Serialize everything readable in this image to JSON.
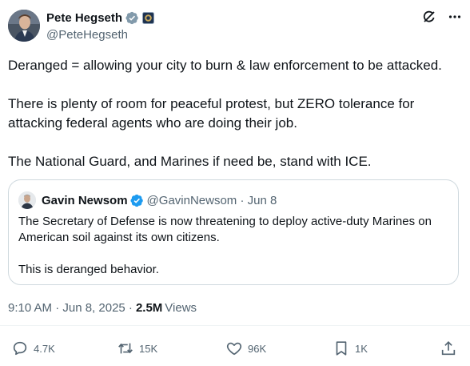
{
  "author": {
    "display_name": "Pete Hegseth",
    "handle": "@PeteHegseth"
  },
  "tweet": {
    "paragraphs": [
      "Deranged = allowing your city to burn & law enforcement to be attacked.",
      "There is plenty of room for peaceful protest, but ZERO tolerance for attacking federal agents who are doing their job.",
      "The National Guard, and Marines if need be, stand with ICE."
    ]
  },
  "quote": {
    "display_name": "Gavin Newsom",
    "handle_date": "@GavinNewsom · Jun 8",
    "paragraphs": [
      "The Secretary of Defense is now threatening to deploy active-duty Marines on American soil against its own citizens.",
      "This is deranged behavior."
    ]
  },
  "meta": {
    "timestamp": "9:10 AM · Jun 8, 2025 ·",
    "views_count": "2.5M",
    "views_label": "Views"
  },
  "actions": {
    "replies": "4.7K",
    "reposts": "15K",
    "likes": "96K",
    "bookmarks": "1K"
  },
  "colors": {
    "gray_badge": "#829aab",
    "blue_badge": "#1d9bf0",
    "secondary_text": "#536471",
    "border": "#cfd9de"
  }
}
